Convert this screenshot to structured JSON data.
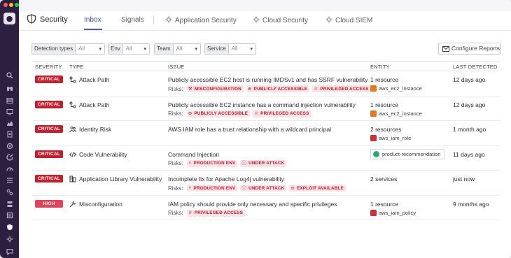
{
  "app": {
    "product_title": "Security",
    "tabs": [
      {
        "label": "Inbox",
        "active": true
      },
      {
        "label": "Signals",
        "active": false
      },
      {
        "label": "Application Security",
        "active": false,
        "icon": "gear-icon"
      },
      {
        "label": "Cloud Security",
        "active": false,
        "icon": "gear-icon"
      },
      {
        "label": "Cloud SIEM",
        "active": false,
        "icon": "gear-icon"
      }
    ]
  },
  "sidebar": {
    "logo_icon": "datadog-logo-icon",
    "items": [
      "search-icon",
      "binoculars-icon",
      "dashboard-icon",
      "monitor-icon",
      "chart-icon",
      "notebook-icon",
      "apm-icon",
      "rum-icon",
      "synthetics-icon",
      "metrics-icon",
      "logs-icon",
      "infrastructure-icon",
      "integrations-icon",
      "security-icon",
      "settings-icon",
      "chat-icon"
    ]
  },
  "filters": [
    {
      "label": "Detection types",
      "value": "All"
    },
    {
      "label": "Env",
      "value": "All"
    },
    {
      "label": "Team",
      "value": "All"
    },
    {
      "label": "Service",
      "value": "All"
    }
  ],
  "configure_button": {
    "label": "Configure Reports",
    "icon": "mail-icon"
  },
  "table": {
    "headers": {
      "severity": "SEVERITY",
      "type": "TYPE",
      "issue": "ISSUE",
      "entity": "ENTITY",
      "last_detected": "LAST DETECTED"
    },
    "risks_label": "Risks:",
    "rows": [
      {
        "severity": "CRITICAL",
        "type": "Attack Path",
        "type_icon": "attack-path-icon",
        "issue": "Publicly accessible EC2 host is running IMDSv1 and has SSRF vulnerability",
        "risks": [
          "MISCONFIGURATION",
          "PUBLICLY ACCESSIBLE",
          "PRIVILEGED ACCESS"
        ],
        "entity": "1 resource",
        "entity_sub": "aws_ec2_instance",
        "last_detected": "12 days ago"
      },
      {
        "severity": "CRITICAL",
        "type": "Attack Path",
        "type_icon": "attack-path-icon",
        "issue": "Publicly accessible EC2 instance has a command injection vulnerability",
        "risks": [
          "PUBLICLY ACCESSIBLE",
          "PRIVILEGED ACCESS"
        ],
        "entity": "1 resource",
        "entity_sub": "aws_ec2_instance",
        "last_detected": "12 days ago"
      },
      {
        "severity": "CRITICAL",
        "type": "Identity Risk",
        "type_icon": "users-icon",
        "issue": "AWS IAM role has a trust relationship with a wildcard principal",
        "risks": [],
        "entity": "2 resources",
        "entity_sub": "aws_iam_role",
        "last_detected": "1 month ago"
      },
      {
        "severity": "CRITICAL",
        "type": "Code Vulnerability",
        "type_icon": "code-icon",
        "issue": "Command Injection",
        "risks": [
          "PRODUCTION ENV",
          "UNDER ATTACK"
        ],
        "entity_service": "product-recommendation",
        "last_detected": "11 days ago"
      },
      {
        "severity": "CRITICAL",
        "type": "Application Library Vulnerability",
        "type_icon": "library-icon",
        "issue": "Incomplete fix for Apache Log4j vulnerability",
        "risks": [
          "PRODUCTION ENV",
          "UNDER ATTACK",
          "EXPLOIT AVAILABLE"
        ],
        "entity": "2 services",
        "last_detected": "just now"
      },
      {
        "severity": "HIGH",
        "type": "Misconfiguration",
        "type_icon": "wrench-icon",
        "issue": "IAM policy should provide only necessary and specific privileges",
        "risks": [
          "PRIVILEGED ACCESS"
        ],
        "entity": "1 resource",
        "entity_sub": "aws_iam_policy",
        "last_detected": "9 months ago"
      }
    ]
  },
  "colors": {
    "critical": "#c21f2f",
    "high": "#e2425a",
    "risk_chip_bg": "#fbe3e6",
    "risk_chip_text": "#b3192b",
    "accent": "#4459c4",
    "sidebar": "#2d1f40"
  }
}
